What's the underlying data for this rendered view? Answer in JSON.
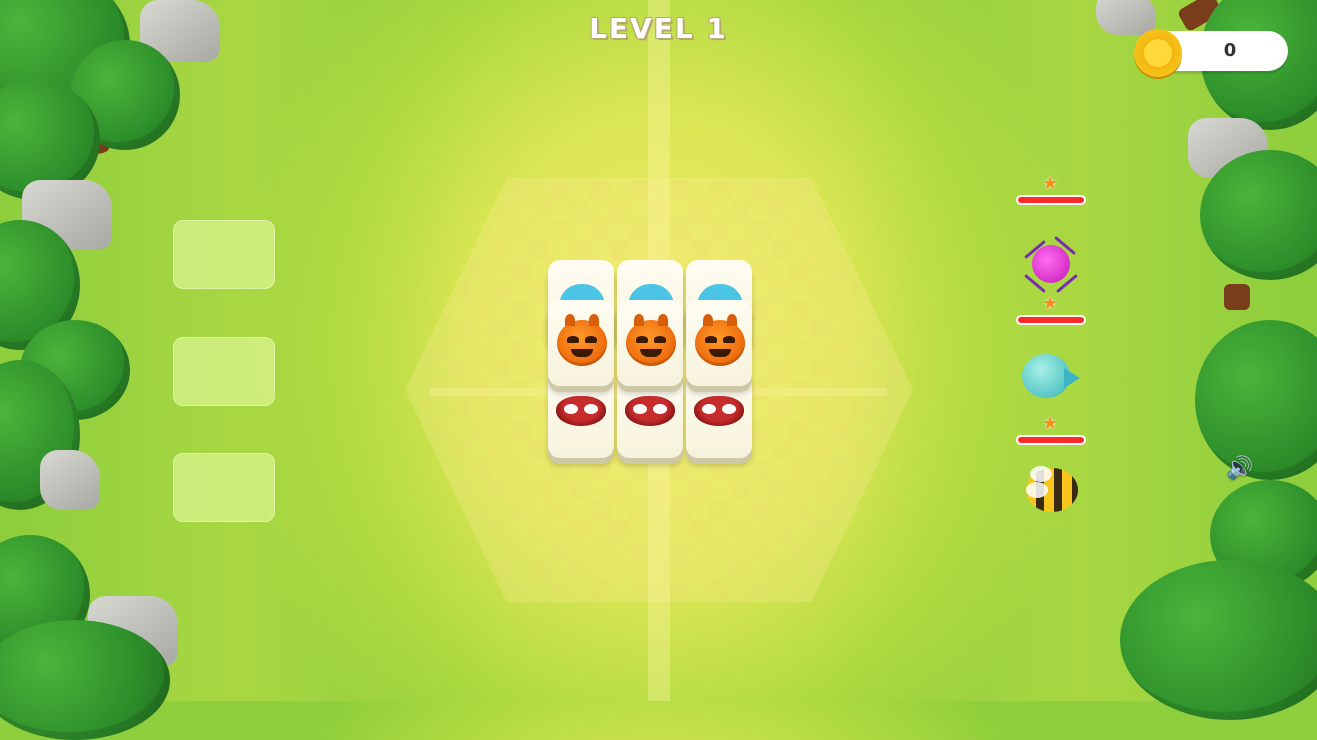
{
  "hud": {
    "level_title": "LEVEL 1",
    "coin_count": "0",
    "coin_icon": "coin-icon",
    "sound_icon": "speaker-icon"
  },
  "slots": {
    "count": 3
  },
  "board": {
    "rows": [
      {
        "icon": "blue-creature",
        "color": "#4cc4e6"
      },
      {
        "icon": "pumpkin-creature",
        "color": "#ef6d0e"
      },
      {
        "icon": "red-bug-creature",
        "color": "#c62c2c"
      }
    ],
    "tiles_per_row": 3
  },
  "enemies": [
    {
      "icon": "pink-spider-icon",
      "health": 1.0,
      "stars": 1
    },
    {
      "icon": "teal-fish-icon",
      "health": 1.0,
      "stars": 1
    },
    {
      "icon": "bee-icon",
      "health": 1.0,
      "stars": 1
    }
  ],
  "colors": {
    "accent": "#ff2a2a",
    "coin": "#f6c21a"
  }
}
